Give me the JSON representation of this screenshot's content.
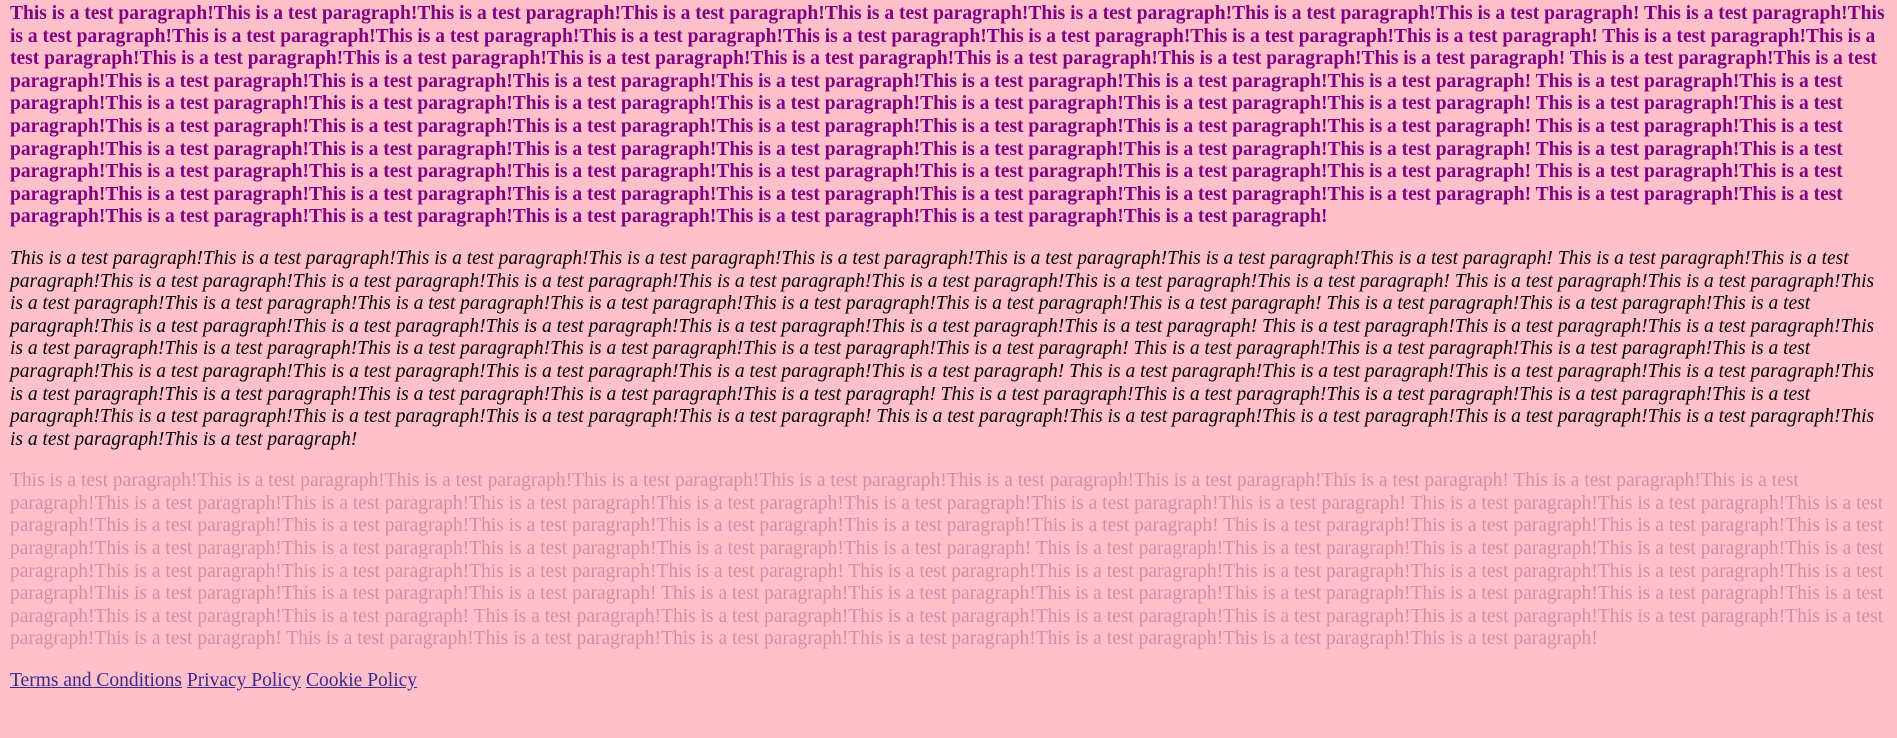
{
  "colors": {
    "background": "#ffc0cb",
    "bold_paragraph": "#800080",
    "italic_paragraph": "#000000",
    "muted_paragraph": "#d88aa6",
    "link": "#3b2a8a"
  },
  "paragraphs": [
    {
      "style": "bold",
      "text": "This is a test paragraph!This is a test paragraph!This is a test paragraph!This is a test paragraph!This is a test paragraph!This is a test paragraph!This is a test paragraph!This is a test paragraph! This is a test paragraph!This is a test paragraph!This is a test paragraph!This is a test paragraph!This is a test paragraph!This is a test paragraph!This is a test paragraph!This is a test paragraph!This is a test paragraph! This is a test paragraph!This is a test paragraph!This is a test paragraph!This is a test paragraph!This is a test paragraph!This is a test paragraph!This is a test paragraph!This is a test paragraph!This is a test paragraph! This is a test paragraph!This is a test paragraph!This is a test paragraph!This is a test paragraph!This is a test paragraph!This is a test paragraph!This is a test paragraph!This is a test paragraph!This is a test paragraph! This is a test paragraph!This is a test paragraph!This is a test paragraph!This is a test paragraph!This is a test paragraph!This is a test paragraph!This is a test paragraph!This is a test paragraph!This is a test paragraph! This is a test paragraph!This is a test paragraph!This is a test paragraph!This is a test paragraph!This is a test paragraph!This is a test paragraph!This is a test paragraph!This is a test paragraph!This is a test paragraph! This is a test paragraph!This is a test paragraph!This is a test paragraph!This is a test paragraph!This is a test paragraph!This is a test paragraph!This is a test paragraph!This is a test paragraph!This is a test paragraph! This is a test paragraph!This is a test paragraph!This is a test paragraph!This is a test paragraph!This is a test paragraph!This is a test paragraph!This is a test paragraph!This is a test paragraph!This is a test paragraph! This is a test paragraph!This is a test paragraph!This is a test paragraph!This is a test paragraph!This is a test paragraph!This is a test paragraph!This is a test paragraph!This is a test paragraph!This is a test paragraph! This is a test paragraph!This is a test paragraph!This is a test paragraph!This is a test paragraph!This is a test paragraph!This is a test paragraph!This is a test paragraph!This is a test paragraph!"
    },
    {
      "style": "italic",
      "text": "This is a test paragraph!This is a test paragraph!This is a test paragraph!This is a test paragraph!This is a test paragraph!This is a test paragraph!This is a test paragraph!This is a test paragraph! This is a test paragraph!This is a test paragraph!This is a test paragraph!This is a test paragraph!This is a test paragraph!This is a test paragraph!This is a test paragraph!This is a test paragraph!This is a test paragraph! This is a test paragraph!This is a test paragraph!This is a test paragraph!This is a test paragraph!This is a test paragraph!This is a test paragraph!This is a test paragraph!This is a test paragraph!This is a test paragraph! This is a test paragraph!This is a test paragraph!This is a test paragraph!This is a test paragraph!This is a test paragraph!This is a test paragraph!This is a test paragraph!This is a test paragraph!This is a test paragraph! This is a test paragraph!This is a test paragraph!This is a test paragraph!This is a test paragraph!This is a test paragraph!This is a test paragraph!This is a test paragraph!This is a test paragraph!This is a test paragraph! This is a test paragraph!This is a test paragraph!This is a test paragraph!This is a test paragraph!This is a test paragraph!This is a test paragraph!This is a test paragraph!This is a test paragraph!This is a test paragraph! This is a test paragraph!This is a test paragraph!This is a test paragraph!This is a test paragraph!This is a test paragraph!This is a test paragraph!This is a test paragraph!This is a test paragraph!This is a test paragraph! This is a test paragraph!This is a test paragraph!This is a test paragraph!This is a test paragraph!This is a test paragraph!This is a test paragraph!This is a test paragraph!This is a test paragraph!This is a test paragraph! This is a test paragraph!This is a test paragraph!This is a test paragraph!This is a test paragraph!This is a test paragraph!This is a test paragraph!This is a test paragraph!"
    },
    {
      "style": "muted",
      "text": "This is a test paragraph!This is a test paragraph!This is a test paragraph!This is a test paragraph!This is a test paragraph!This is a test paragraph!This is a test paragraph!This is a test paragraph! This is a test paragraph!This is a test paragraph!This is a test paragraph!This is a test paragraph!This is a test paragraph!This is a test paragraph!This is a test paragraph!This is a test paragraph!This is a test paragraph! This is a test paragraph!This is a test paragraph!This is a test paragraph!This is a test paragraph!This is a test paragraph!This is a test paragraph!This is a test paragraph!This is a test paragraph!This is a test paragraph! This is a test paragraph!This is a test paragraph!This is a test paragraph!This is a test paragraph!This is a test paragraph!This is a test paragraph!This is a test paragraph!This is a test paragraph!This is a test paragraph! This is a test paragraph!This is a test paragraph!This is a test paragraph!This is a test paragraph!This is a test paragraph!This is a test paragraph!This is a test paragraph!This is a test paragraph!This is a test paragraph! This is a test paragraph!This is a test paragraph!This is a test paragraph!This is a test paragraph!This is a test paragraph!This is a test paragraph!This is a test paragraph!This is a test paragraph!This is a test paragraph! This is a test paragraph!This is a test paragraph!This is a test paragraph!This is a test paragraph!This is a test paragraph!This is a test paragraph!This is a test paragraph!This is a test paragraph!This is a test paragraph! This is a test paragraph!This is a test paragraph!This is a test paragraph!This is a test paragraph!This is a test paragraph!This is a test paragraph!This is a test paragraph!This is a test paragraph!This is a test paragraph! This is a test paragraph!This is a test paragraph!This is a test paragraph!This is a test paragraph!This is a test paragraph!This is a test paragraph!This is a test paragraph!"
    }
  ],
  "footer": {
    "links": [
      "Terms and Conditions",
      "Privacy Policy",
      "Cookie Policy"
    ]
  }
}
